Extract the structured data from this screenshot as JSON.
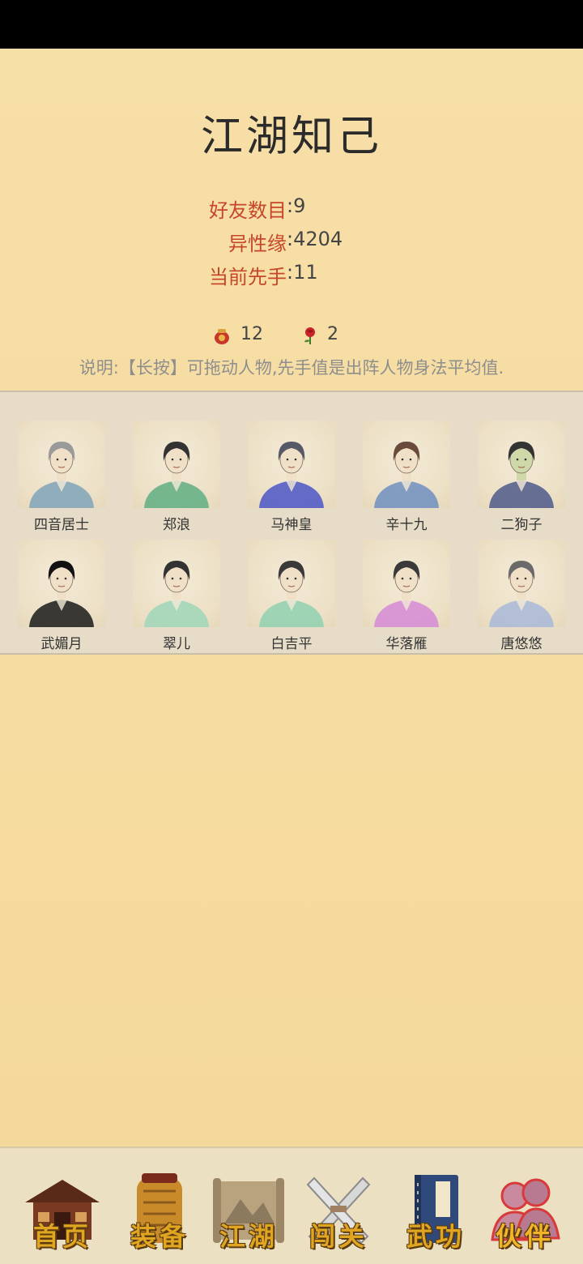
{
  "page": {
    "title": "江湖知己"
  },
  "stats": [
    {
      "label": "好友数目",
      "value": ":9"
    },
    {
      "label": "异性缘",
      "value": ":4204"
    },
    {
      "label": "当前先手",
      "value": ":11"
    }
  ],
  "currency": {
    "coins": "12",
    "roses": "2"
  },
  "note": "说明:【长按】可拖动人物,先手值是出阵人物身法平均值.",
  "characters": [
    {
      "name": "四音居士",
      "robe": "#7fa3b8",
      "hair": "#9a9a9a",
      "skin": "#f1e0c8"
    },
    {
      "name": "郑浪",
      "robe": "#5fae82",
      "hair": "#333333",
      "skin": "#f1e0c8"
    },
    {
      "name": "马神皇",
      "robe": "#4b56c6",
      "hair": "#555a66",
      "skin": "#f1e0c8"
    },
    {
      "name": "辛十九",
      "robe": "#6f8fc0",
      "hair": "#6a4a3a",
      "skin": "#f1e0c8"
    },
    {
      "name": "二狗子",
      "robe": "#4e5a8a",
      "hair": "#333333",
      "skin": "#cfd8a8"
    },
    {
      "name": "武媚月",
      "robe": "#1a1a1a",
      "hair": "#111111",
      "skin": "#f1e0c8"
    },
    {
      "name": "翠儿",
      "robe": "#9fd6b8",
      "hair": "#333333",
      "skin": "#f1e0c8"
    },
    {
      "name": "白吉平",
      "robe": "#8fd0b0",
      "hair": "#3a3a3a",
      "skin": "#f1e0c8"
    },
    {
      "name": "华落雁",
      "robe": "#d58ad6",
      "hair": "#3a3a3a",
      "skin": "#f1e0c8"
    },
    {
      "name": "唐悠悠",
      "robe": "#a8b8d8",
      "hair": "#6a6a6a",
      "skin": "#f1e0c8"
    }
  ],
  "nav": {
    "items": [
      {
        "label": "首页",
        "icon": "house-icon"
      },
      {
        "label": "装备",
        "icon": "armor-icon"
      },
      {
        "label": "江湖",
        "icon": "map-scroll-icon"
      },
      {
        "label": "闯关",
        "icon": "crossed-swords-icon"
      },
      {
        "label": "武功",
        "icon": "manual-book-icon"
      },
      {
        "label": "伙伴",
        "icon": "companions-icon"
      }
    ],
    "active": "伙伴"
  },
  "colors": {
    "label_red": "#c5462a",
    "nav_gold": "#e0a521",
    "paper": "#f6dda2"
  }
}
